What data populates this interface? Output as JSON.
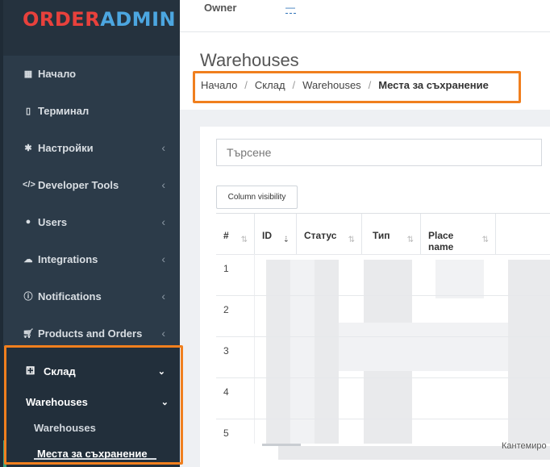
{
  "logo": {
    "part1": "ORDER",
    "part2": "ADMIN"
  },
  "topbar": {
    "owner_label": "Owner",
    "owner_value": "—"
  },
  "sidebar": {
    "items": [
      {
        "label": "Начало",
        "icon": "grid-icon"
      },
      {
        "label": "Терминал",
        "icon": "tablet-icon"
      },
      {
        "label": "Настройки",
        "icon": "gear-icon"
      },
      {
        "label": "Developer Tools",
        "icon": "code-icon"
      },
      {
        "label": "Users",
        "icon": "user-icon"
      },
      {
        "label": "Integrations",
        "icon": "cloud-icon"
      },
      {
        "label": "Notifications",
        "icon": "info-icon"
      },
      {
        "label": "Products and Orders",
        "icon": "cart-icon"
      }
    ],
    "sklad": {
      "label": "Склад",
      "icon": "cubes-icon"
    },
    "warehouses_group": "Warehouses",
    "warehouses_item": "Warehouses",
    "storage_item": "Места за съхранение"
  },
  "page": {
    "title": "Warehouses",
    "breadcrumb": [
      "Начало",
      "Склад",
      "Warehouses",
      "Места за съхранение"
    ]
  },
  "search": {
    "placeholder": "Търсене"
  },
  "column_visibility_label": "Column visibility",
  "table": {
    "headers": [
      "#",
      "ID",
      "Статус",
      "Тип",
      "Place name"
    ],
    "rows": [
      "1",
      "2",
      "3",
      "4",
      "5"
    ]
  },
  "footer_partial_text": "Кантемиро",
  "colors": {
    "accent": "#f07f1e",
    "sidebar": "#2c3b49",
    "active": "#3aa17e"
  }
}
